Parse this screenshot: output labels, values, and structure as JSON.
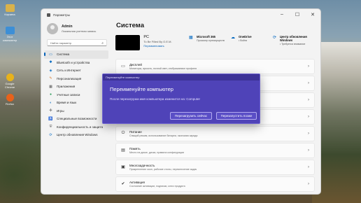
{
  "desktop": {
    "icons": [
      {
        "label": "Корзина",
        "icon": "recycle-bin-icon",
        "color": "#d9b24a"
      },
      {
        "label": "Этот компьютер",
        "icon": "computer-icon",
        "color": "#3d8fd6"
      },
      {
        "label": "Google Chrome",
        "icon": "chrome-icon",
        "color": "#e8b21b"
      },
      {
        "label": "Firefox",
        "icon": "firefox-icon",
        "color": "#e8621b"
      }
    ]
  },
  "window": {
    "title": "Параметры",
    "controls": {
      "minimize": "–",
      "maximize": "☐",
      "close": "✕"
    }
  },
  "sidebar": {
    "user_name": "Admin",
    "user_subtitle": "Локальная учетная запись",
    "search_placeholder": "Найти параметр",
    "items": [
      {
        "label": "Система",
        "icon": "monitor-icon",
        "glyph": "▭",
        "color": "#0067c0"
      },
      {
        "label": "Bluetooth и устройства",
        "icon": "bluetooth-icon",
        "glyph": "✱",
        "color": "#0067c0"
      },
      {
        "label": "Сеть и Интернет",
        "icon": "wifi-icon",
        "glyph": "◈",
        "color": "#0067c0"
      },
      {
        "label": "Персонализация",
        "icon": "brush-icon",
        "glyph": "✎",
        "color": "#d97a2b"
      },
      {
        "label": "Приложения",
        "icon": "apps-icon",
        "glyph": "▦",
        "color": "#555555"
      },
      {
        "label": "Учетные записи",
        "icon": "account-icon",
        "glyph": "●",
        "color": "#2e9d5b"
      },
      {
        "label": "Время и язык",
        "icon": "globe-clock-icon",
        "glyph": "◐",
        "color": "#0067c0"
      },
      {
        "label": "Игры",
        "icon": "gamepad-icon",
        "glyph": "✜",
        "color": "#555555"
      },
      {
        "label": "Специальные возможности",
        "icon": "accessibility-icon",
        "glyph": "♿",
        "color": "#0067c0"
      },
      {
        "label": "Конфиденциальность и защита",
        "icon": "shield-icon",
        "glyph": "⛨",
        "color": "#555555"
      },
      {
        "label": "Центр обновления Windows",
        "icon": "update-icon",
        "glyph": "⟳",
        "color": "#0067c0"
      }
    ]
  },
  "main": {
    "title": "Система",
    "pc": {
      "name": "PC",
      "model": "To Be Filled By O.E.M.",
      "rename": "Переименовать"
    },
    "tiles": [
      {
        "title": "Microsoft 365",
        "subtitle": "Просмотр преимуществ",
        "icon": "microsoft-365-icon",
        "glyph": "▦"
      },
      {
        "title": "OneDrive",
        "subtitle": "• Войти",
        "icon": "cloud-icon",
        "glyph": "☁"
      },
      {
        "title": "Центр обновления Windows",
        "subtitle": "• Требуется внимание",
        "icon": "update-icon",
        "glyph": "⟳"
      }
    ],
    "cards": [
      {
        "title": "Дисплей",
        "subtitle": "Мониторы, яркость, ночной свет, отображаемое профиля",
        "icon": "display-icon",
        "glyph": "▭"
      },
      {
        "title": "",
        "subtitle": "",
        "icon": "",
        "glyph": ""
      },
      {
        "title": "",
        "subtitle": "",
        "icon": "",
        "glyph": ""
      },
      {
        "title": "",
        "subtitle": "",
        "icon": "",
        "glyph": ""
      },
      {
        "title": "Питание",
        "subtitle": "Спящий режим, использование батареи, экономия заряда",
        "icon": "power-icon",
        "glyph": "⏻"
      },
      {
        "title": "Память",
        "subtitle": "Место на диске, диски, правила конфигурации",
        "icon": "storage-icon",
        "glyph": "▤"
      },
      {
        "title": "Многозадачность",
        "subtitle": "Прикрепление окон, рабочие столы, переключение задач",
        "icon": "multitask-icon",
        "glyph": "▣"
      },
      {
        "title": "Активация",
        "subtitle": "Состояние активации, подписки, ключ продукта",
        "icon": "activation-icon",
        "glyph": "✔"
      }
    ],
    "chevron": "›"
  },
  "dialog": {
    "titlebar": "Переименуйте компьютер",
    "heading": "Переименуйте компьютер",
    "body": "После перезагрузки имя компьютера изменится на: Computer",
    "restart_now": "Перезагрузить сейчас",
    "restart_later": "Перезапустить позже"
  }
}
